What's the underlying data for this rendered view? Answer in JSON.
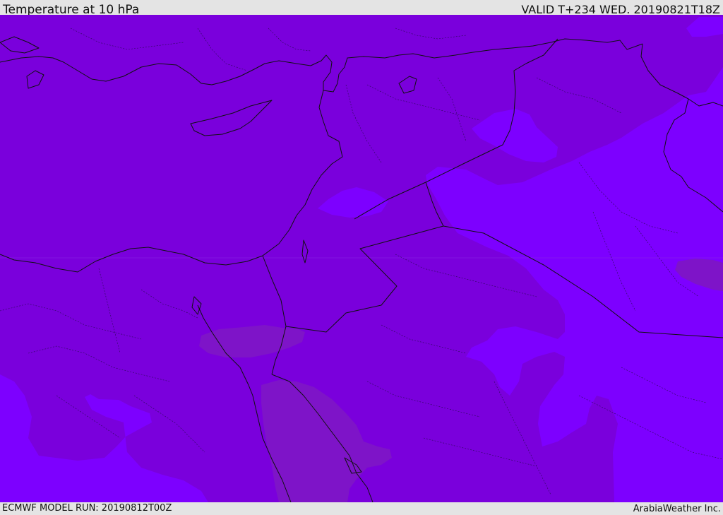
{
  "header": {
    "title": "Temperature at 10 hPa",
    "valid": "VALID T+234 WED. 20190821T18Z"
  },
  "footer": {
    "model_run": "ECMWF MODEL RUN: 20190812T00Z",
    "credit": "ArabiaWeather Inc."
  },
  "map": {
    "colors": {
      "base": "#7a00dc",
      "light": "#7d00ff",
      "dark": "#7e14c8",
      "border": "#111111"
    }
  }
}
